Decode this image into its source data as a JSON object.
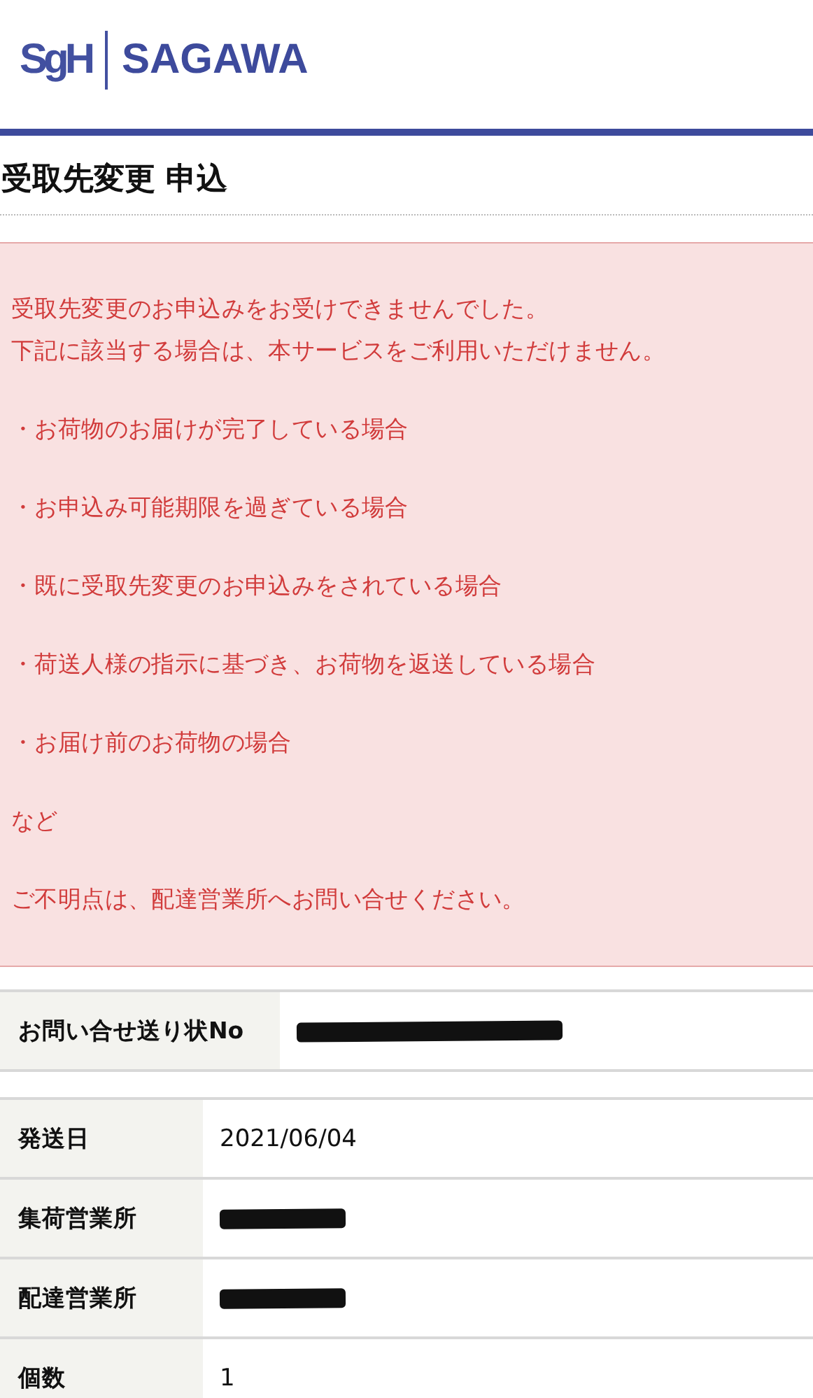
{
  "header": {
    "logo_mark": "SgH",
    "logo_text": "SAGAWA"
  },
  "page_title": "受取先変更 申込",
  "alert": {
    "paragraphs": [
      [
        "受取先変更のお申込みをお受けできませんでした。",
        "下記に該当する場合は、本サービスをご利用いただけません。"
      ],
      [
        "・お荷物のお届けが完了している場合"
      ],
      [
        "・お申込み可能期限を過ぎている場合"
      ],
      [
        "・既に受取先変更のお申込みをされている場合"
      ],
      [
        "・荷送人様の指示に基づき、お荷物を返送している場合"
      ],
      [
        "・お届け前のお荷物の場合"
      ],
      [
        "など"
      ],
      [
        "ご不明点は、配達営業所へお問い合せください。"
      ]
    ]
  },
  "tracking_table": {
    "rows": [
      {
        "label": "お問い合せ送り状No",
        "redacted": true
      }
    ]
  },
  "detail_table": {
    "rows": [
      {
        "label": "発送日",
        "value": "2021/06/04",
        "redacted": false
      },
      {
        "label": "集荷営業所",
        "redacted": true
      },
      {
        "label": "配達営業所",
        "redacted": true
      },
      {
        "label": "個数",
        "value": "1",
        "redacted": false
      }
    ]
  }
}
